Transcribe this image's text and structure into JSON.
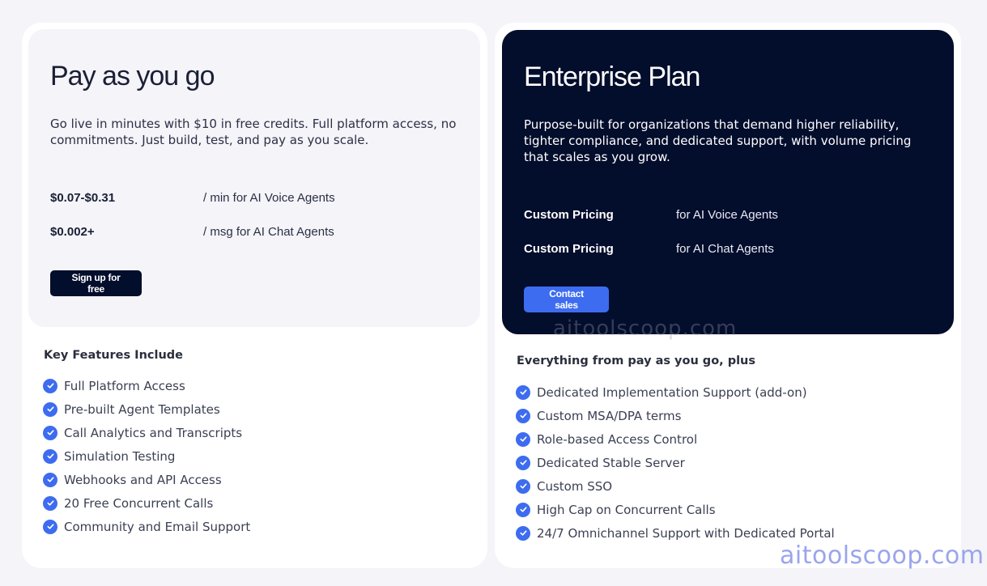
{
  "payg": {
    "title": "Pay as you go",
    "description": "Go live in minutes with $10 in free credits. Full platform access, no commitments. Just build, test, and pay as you scale.",
    "pricing": [
      {
        "amount": "$0.07-$0.31",
        "unit": "/ min for AI Voice Agents"
      },
      {
        "amount": "$0.002+",
        "unit": "/ msg for AI Chat Agents"
      }
    ],
    "cta_label": "Sign up for free",
    "features_heading": "Key Features Include",
    "features": [
      "Full Platform Access",
      "Pre-built Agent Templates",
      "Call Analytics and Transcripts",
      "Simulation Testing",
      "Webhooks and API Access",
      "20 Free Concurrent Calls",
      "Community and Email Support"
    ]
  },
  "enterprise": {
    "title": "Enterprise Plan",
    "description": "Purpose-built for organizations that demand higher reliability, tighter compliance, and dedicated support, with volume pricing that scales as you grow.",
    "pricing": [
      {
        "amount": "Custom Pricing",
        "unit": "for AI Voice Agents"
      },
      {
        "amount": "Custom Pricing",
        "unit": "for AI Chat Agents"
      }
    ],
    "cta_label": "Contact sales",
    "features_heading": "Everything from pay as you go, plus",
    "features": [
      "Dedicated Implementation Support (add-on)",
      "Custom MSA/DPA terms",
      "Role-based Access Control",
      "Dedicated Stable Server",
      "Custom SSO",
      "High Cap on Concurrent Calls",
      "24/7 Omnichannel Support with Dedicated Portal"
    ]
  },
  "watermark": "aitoolscoop.com",
  "colors": {
    "accent": "#3d6cf0",
    "dark_navy": "#030d2c",
    "page_bg": "#f4f4f9"
  },
  "icons": {
    "feature_bullet": "check-circle-icon"
  }
}
